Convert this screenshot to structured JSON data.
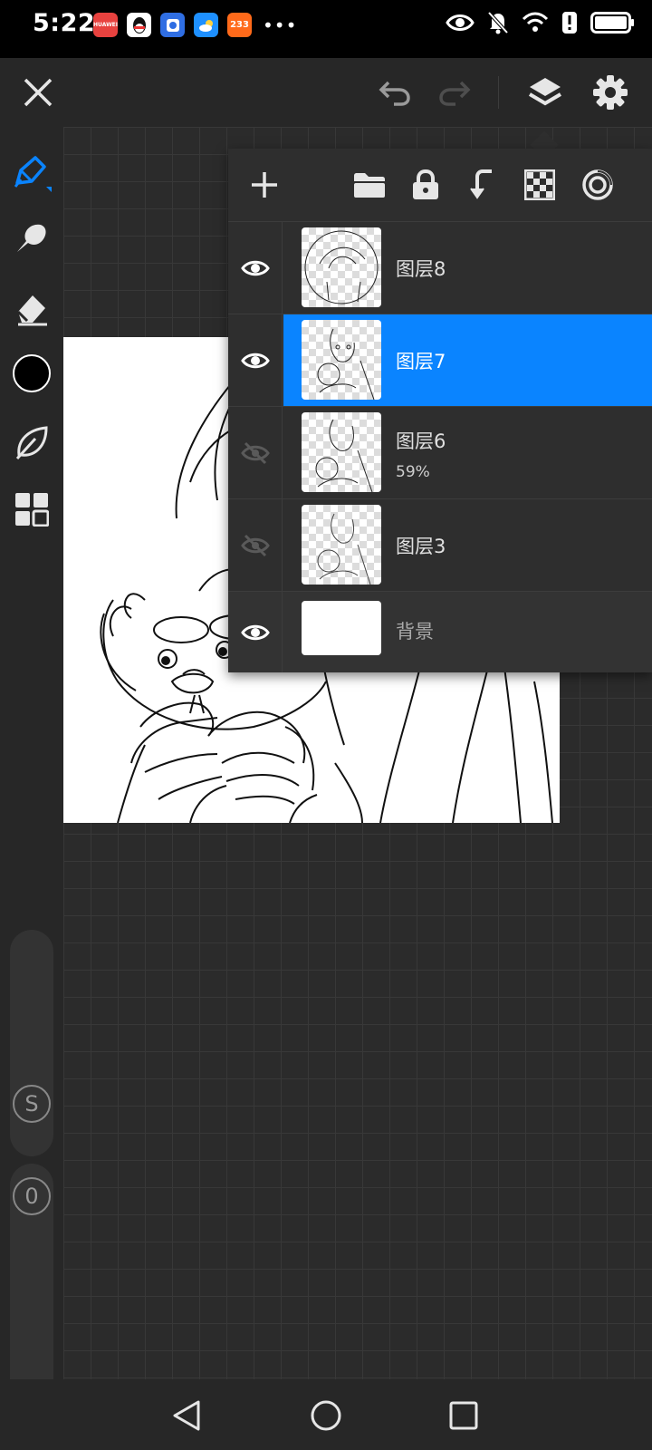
{
  "status_bar": {
    "time": "5:22",
    "notifications": [
      {
        "icon": "huawei-store-icon",
        "color": "#e8423f",
        "text": "HUAWEI"
      },
      {
        "icon": "qq-icon",
        "color": "#ffffff",
        "text": ""
      },
      {
        "icon": "mobile-manager-icon",
        "color": "#2f6ee3",
        "text": ""
      },
      {
        "icon": "weather-icon",
        "color": "#1e90ff",
        "text": ""
      },
      {
        "icon": "app-233-icon",
        "color": "#ff6a1a",
        "text": "233"
      }
    ],
    "more": "•••",
    "system_icons": [
      "eye-comfort-icon",
      "mute-icon",
      "wifi-icon",
      "alert-icon",
      "battery-icon"
    ]
  },
  "topbar": {
    "icons": [
      "close-icon",
      "undo-icon",
      "redo-icon",
      "layers-icon",
      "settings-icon"
    ]
  },
  "left_tools": {
    "icons": [
      "brush-icon",
      "smudge-icon",
      "eraser-icon",
      "color-swatch",
      "leaf-icon",
      "gallery-icon"
    ],
    "active_color": "#000000",
    "size_label": "S",
    "opacity_label": "0"
  },
  "layers_panel": {
    "toolbar_icons": [
      "add-layer-icon",
      "folder-icon",
      "lock-icon",
      "merge-down-icon",
      "transparency-icon",
      "blend-icon"
    ],
    "layers": [
      {
        "name": "图层8",
        "visible": true,
        "selected": false,
        "opacity": ""
      },
      {
        "name": "图层7",
        "visible": true,
        "selected": true,
        "opacity": ""
      },
      {
        "name": "图层6",
        "visible": false,
        "selected": false,
        "opacity": "59%"
      },
      {
        "name": "图层3",
        "visible": false,
        "selected": false,
        "opacity": ""
      },
      {
        "name": "背景",
        "visible": true,
        "selected": false,
        "opacity": ""
      }
    ]
  },
  "navbar": {
    "icons": [
      "back-icon",
      "home-icon",
      "recents-icon"
    ]
  },
  "colors": {
    "accent": "#0a84ff",
    "panel": "#2e2e2e",
    "toolbar": "#272727"
  }
}
